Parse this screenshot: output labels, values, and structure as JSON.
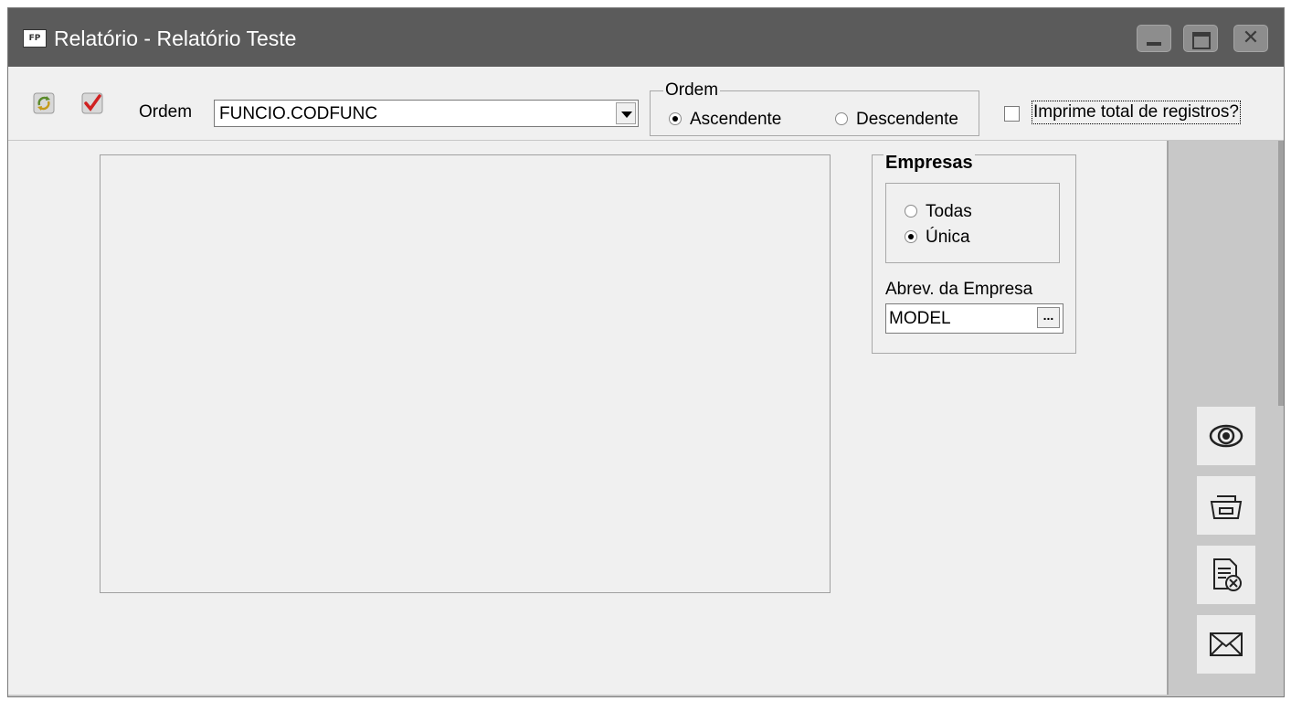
{
  "window": {
    "app_icon_text": "FP",
    "title": "Relatório - Relatório Teste"
  },
  "toolbar": {
    "refresh_icon": "refresh-icon",
    "confirm_icon": "check-icon",
    "ordem_label": "Ordem",
    "ordem_value": "FUNCIO.CODFUNC"
  },
  "ordem_group": {
    "legend": "Ordem",
    "options": [
      {
        "label": "Ascendente",
        "selected": true
      },
      {
        "label": "Descendente",
        "selected": false
      }
    ]
  },
  "total_checkbox": {
    "label": "Imprime total de registros?",
    "checked": false
  },
  "empresas": {
    "legend": "Empresas",
    "options": [
      {
        "label": "Todas",
        "selected": false
      },
      {
        "label": "Única",
        "selected": true
      }
    ],
    "abrev_label": "Abrev. da Empresa",
    "abrev_value": "MODEL",
    "lookup_button": "..."
  },
  "side_actions": [
    {
      "name": "preview",
      "icon": "eye-icon"
    },
    {
      "name": "print",
      "icon": "printer-icon"
    },
    {
      "name": "cancel-report",
      "icon": "document-cancel-icon"
    },
    {
      "name": "email",
      "icon": "envelope-icon"
    }
  ]
}
